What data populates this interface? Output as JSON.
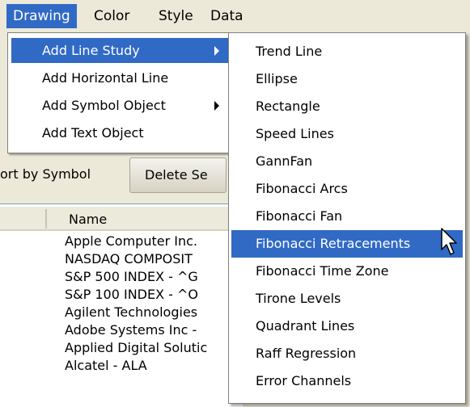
{
  "menubar": {
    "items": [
      {
        "label": "Drawing",
        "active": true
      },
      {
        "label": "Color",
        "active": false
      },
      {
        "label": "Style",
        "active": false
      },
      {
        "label": "Data",
        "active": false
      }
    ]
  },
  "drawing_menu": {
    "items": [
      {
        "label": "Add Line Study",
        "submenu": true,
        "active": true
      },
      {
        "label": "Add Horizontal Line",
        "submenu": false,
        "active": false
      },
      {
        "label": "Add Symbol Object",
        "submenu": true,
        "active": false
      },
      {
        "label": "Add Text Object",
        "submenu": false,
        "active": false
      }
    ]
  },
  "line_study_submenu": {
    "items": [
      {
        "label": "Trend Line",
        "active": false
      },
      {
        "label": "Ellipse",
        "active": false
      },
      {
        "label": "Rectangle",
        "active": false
      },
      {
        "label": "Speed Lines",
        "active": false
      },
      {
        "label": "GannFan",
        "active": false
      },
      {
        "label": "Fibonacci Arcs",
        "active": false
      },
      {
        "label": "Fibonacci Fan",
        "active": false
      },
      {
        "label": "Fibonacci Retracements",
        "active": true
      },
      {
        "label": "Fibonacci Time Zone",
        "active": false
      },
      {
        "label": "Tirone Levels",
        "active": false
      },
      {
        "label": "Quadrant Lines",
        "active": false
      },
      {
        "label": "Raff Regression",
        "active": false
      },
      {
        "label": "Error Channels",
        "active": false
      }
    ]
  },
  "toolbar": {
    "sort_label": "ort by Symbol",
    "delete_label": "Delete Se"
  },
  "list": {
    "header_name": "Name",
    "rows": [
      "Apple Computer Inc.",
      "NASDAQ COMPOSIT",
      "S&P 500 INDEX - ^G",
      "S&P 100 INDEX - ^O",
      "Agilent Technologies",
      "Adobe Systems Inc -",
      "Applied Digital Solutic",
      "Alcatel - ALA"
    ]
  },
  "colors": {
    "highlight": "#316ac5",
    "menu_bg": "#ffffff",
    "window_bg": "#ece9d8"
  }
}
